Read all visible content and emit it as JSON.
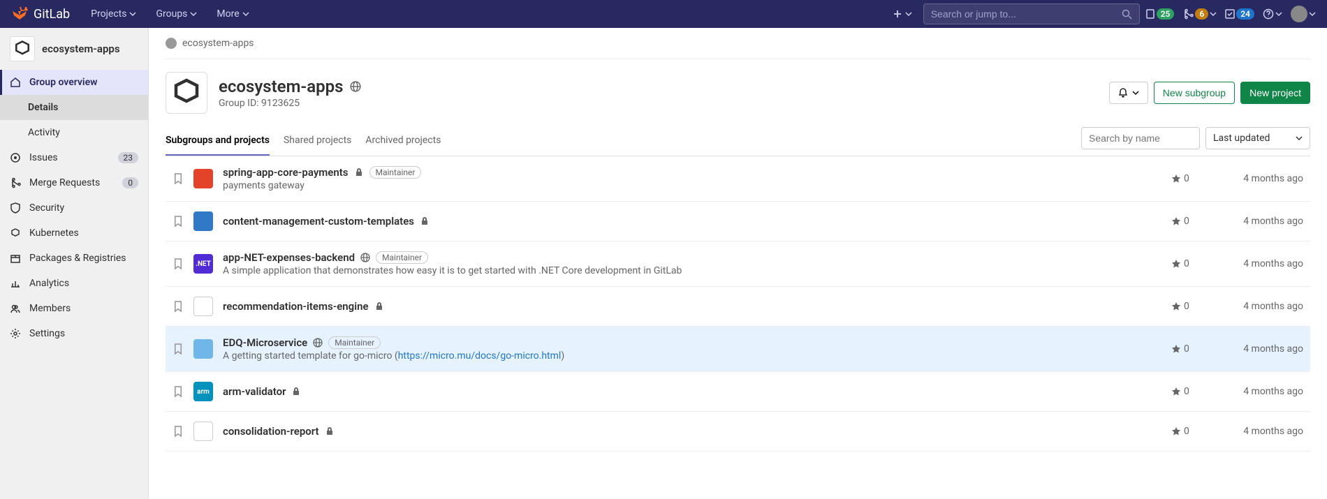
{
  "topnav": {
    "brand": "GitLab",
    "menu": [
      "Projects",
      "Groups",
      "More"
    ],
    "search_placeholder": "Search or jump to...",
    "badges": {
      "todos": "25",
      "mrs": "6",
      "issues": "24"
    }
  },
  "sidebar": {
    "context_name": "ecosystem-apps",
    "items": [
      {
        "label": "Group overview",
        "icon": "home",
        "active": true
      },
      {
        "label": "Issues",
        "icon": "issues",
        "count": "23"
      },
      {
        "label": "Merge Requests",
        "icon": "merge",
        "count": "0"
      },
      {
        "label": "Security",
        "icon": "shield"
      },
      {
        "label": "Kubernetes",
        "icon": "kube"
      },
      {
        "label": "Packages & Registries",
        "icon": "package"
      },
      {
        "label": "Analytics",
        "icon": "chart"
      },
      {
        "label": "Members",
        "icon": "members"
      },
      {
        "label": "Settings",
        "icon": "gear"
      }
    ],
    "sub_items": [
      {
        "label": "Details",
        "active": true
      },
      {
        "label": "Activity",
        "active": false
      }
    ]
  },
  "breadcrumb": {
    "text": "ecosystem-apps"
  },
  "group": {
    "name": "ecosystem-apps",
    "id_label": "Group ID: 9123625",
    "visibility": "public",
    "actions": {
      "new_subgroup": "New subgroup",
      "new_project": "New project"
    }
  },
  "tabs": [
    "Subgroups and projects",
    "Shared projects",
    "Archived projects"
  ],
  "filters": {
    "search_placeholder": "Search by name",
    "sort": "Last updated"
  },
  "projects": [
    {
      "name": "spring-app-core-payments",
      "desc": "payments gateway",
      "role": "Maintainer",
      "visibility": "private",
      "stars": "0",
      "time": "4 months ago",
      "avatar_color": "#e24329",
      "highlighted": false
    },
    {
      "name": "content-management-custom-templates",
      "desc": "",
      "role": "",
      "visibility": "private",
      "stars": "0",
      "time": "4 months ago",
      "avatar_color": "#3178c6",
      "highlighted": false
    },
    {
      "name": "app-NET-expenses-backend",
      "desc": "A simple application that demonstrates how easy it is to get started with .NET Core development in GitLab",
      "role": "Maintainer",
      "visibility": "public",
      "stars": "0",
      "time": "4 months ago",
      "avatar_color": "#512bd4",
      "avatar_text": ".NET",
      "highlighted": false
    },
    {
      "name": "recommendation-items-engine",
      "desc": "",
      "role": "",
      "visibility": "private",
      "stars": "0",
      "time": "4 months ago",
      "avatar_color": "#fff",
      "highlighted": false
    },
    {
      "name": "EDQ-Microservice",
      "desc_pre": "A getting started template for go-micro (",
      "desc_link": "https://micro.mu/docs/go-micro.html",
      "desc_post": ")",
      "role": "Maintainer",
      "visibility": "public",
      "stars": "0",
      "time": "4 months ago",
      "avatar_color": "#6fb7e8",
      "highlighted": true
    },
    {
      "name": "arm-validator",
      "desc": "",
      "role": "",
      "visibility": "private",
      "stars": "0",
      "time": "4 months ago",
      "avatar_color": "#0091bd",
      "avatar_text": "arm",
      "highlighted": false
    },
    {
      "name": "consolidation-report",
      "desc": "",
      "role": "",
      "visibility": "private",
      "stars": "0",
      "time": "4 months ago",
      "avatar_color": "#fff",
      "highlighted": false
    }
  ]
}
